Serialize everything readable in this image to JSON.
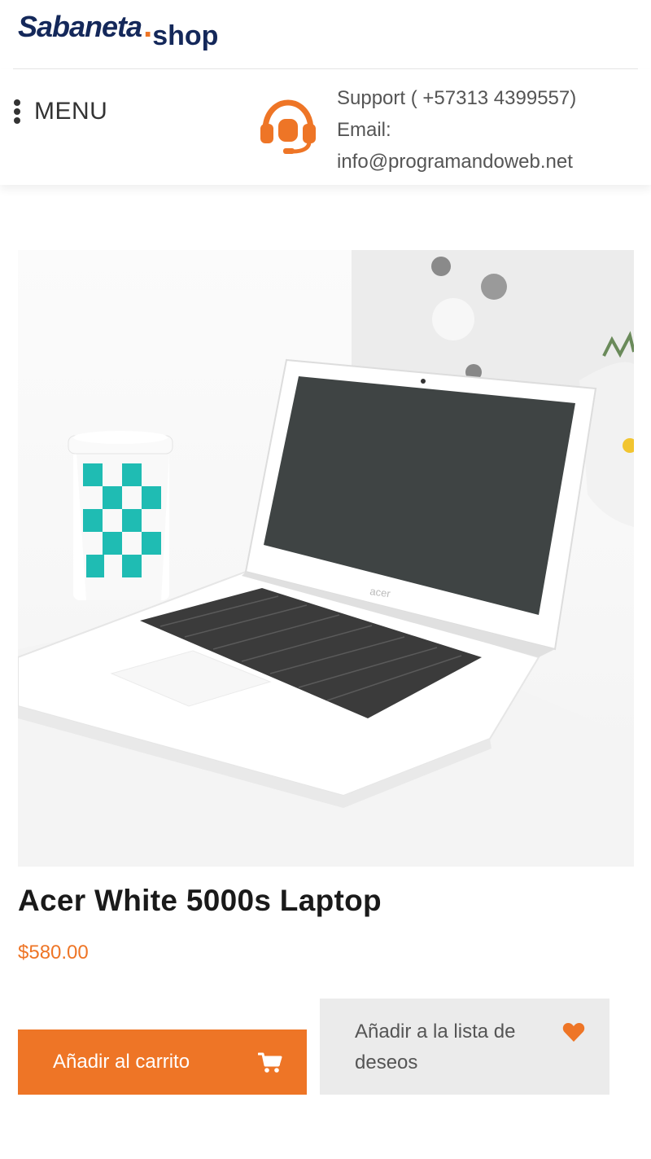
{
  "header": {
    "logo": {
      "main": "Sabaneta",
      "dot": ".",
      "suffix": "shop"
    },
    "menu_label": "MENU",
    "support": {
      "phone_line": "Support ( +57313 4399557)",
      "email_label": "Email:",
      "email": "info@programandoweb.net"
    }
  },
  "product": {
    "title": "Acer White 5000s Laptop",
    "price": "$580.00",
    "add_to_cart_label": "Añadir al carrito",
    "wishlist_label": "Añadir a la lista de deseos"
  },
  "colors": {
    "accent": "#ee7526",
    "brand": "#14285a",
    "wishlist_bg": "#ebebeb"
  },
  "icons": [
    "menu-dots-icon",
    "headset-icon",
    "cart-icon",
    "heart-icon"
  ]
}
